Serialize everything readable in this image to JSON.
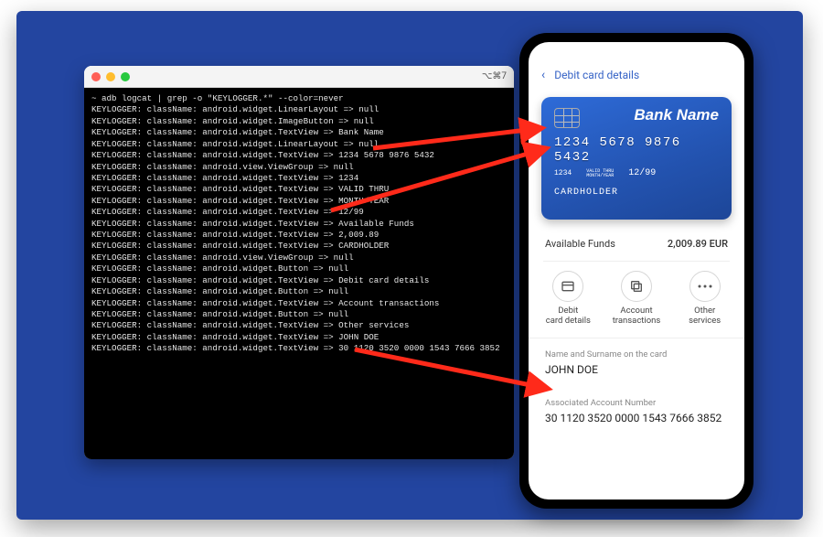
{
  "terminal": {
    "titlebar_right": "⌥⌘7",
    "cmd": "~ adb logcat | grep -o \"KEYLOGGER.*\" --color=never",
    "lines": [
      "KEYLOGGER: className: android.widget.LinearLayout => null",
      "KEYLOGGER: className: android.widget.ImageButton => null",
      "KEYLOGGER: className: android.widget.TextView => Bank Name",
      "KEYLOGGER: className: android.widget.LinearLayout => null",
      "KEYLOGGER: className: android.widget.TextView => 1234 5678 9876 5432",
      "KEYLOGGER: className: android.view.ViewGroup => null",
      "KEYLOGGER: className: android.widget.TextView => 1234",
      "KEYLOGGER: className: android.widget.TextView => VALID THRU",
      "KEYLOGGER: className: android.widget.TextView => MONTH/YEAR",
      "KEYLOGGER: className: android.widget.TextView => 12/99",
      "KEYLOGGER: className: android.widget.TextView => Available Funds",
      "KEYLOGGER: className: android.widget.TextView => 2,009.89",
      "KEYLOGGER: className: android.widget.TextView => CARDHOLDER",
      "KEYLOGGER: className: android.view.ViewGroup => null",
      "KEYLOGGER: className: android.widget.Button => null",
      "KEYLOGGER: className: android.widget.TextView => Debit card details",
      "KEYLOGGER: className: android.widget.Button => null",
      "KEYLOGGER: className: android.widget.TextView => Account transactions",
      "KEYLOGGER: className: android.widget.Button => null",
      "KEYLOGGER: className: android.widget.TextView => Other services",
      "KEYLOGGER: className: android.widget.TextView => JOHN DOE",
      "KEYLOGGER: className: android.widget.TextView => 30 1120 3520 0000 1543 7666 3852"
    ]
  },
  "phone": {
    "header": {
      "back": "‹",
      "title": "Debit card details"
    },
    "card": {
      "bank": "Bank Name",
      "pan": "1234  5678  9876  5432",
      "small_pan": "1234",
      "valid_label": "VALID THRU",
      "month_label": "MONTH/YEAR",
      "expiry": "12/99",
      "holder": "CARDHOLDER"
    },
    "funds": {
      "label": "Available Funds",
      "value": "2,009.89 EUR"
    },
    "actions": [
      {
        "label": "Debit card details"
      },
      {
        "label": "Account transactions"
      },
      {
        "label": "Other services"
      }
    ],
    "name_label": "Name and Surname on the card",
    "name_value": "JOHN DOE",
    "acct_label": "Associated Account Number",
    "acct_value": "30 1120 3520 0000 1543 7666 3852"
  }
}
